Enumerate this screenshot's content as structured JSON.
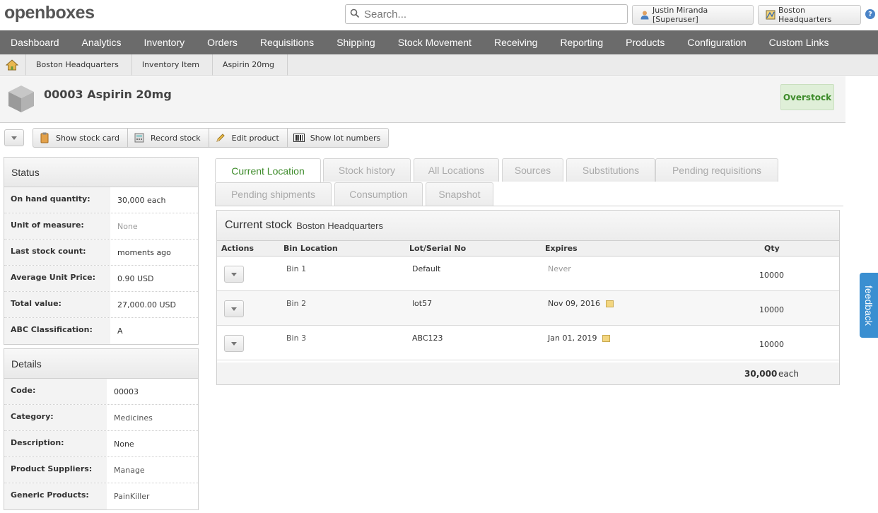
{
  "header": {
    "logo": "openboxes",
    "search_placeholder": "Search...",
    "user_label": "Justin Miranda [Superuser]",
    "location_label": "Boston Headquarters",
    "help_icon": "question-icon"
  },
  "nav": {
    "items": [
      "Dashboard",
      "Analytics",
      "Inventory",
      "Orders",
      "Requisitions",
      "Shipping",
      "Stock Movement",
      "Receiving",
      "Reporting",
      "Products",
      "Configuration",
      "Custom Links"
    ]
  },
  "breadcrumb": {
    "home_icon": "home-icon",
    "items": [
      "Boston Headquarters",
      "Inventory Item",
      "Aspirin 20mg"
    ]
  },
  "product": {
    "title": "00003 Aspirin 20mg",
    "badge": "Overstock",
    "badge_color": "#3d8b2a"
  },
  "toolbar": {
    "buttons": [
      {
        "label": "Show stock card",
        "icon": "clipboard-icon"
      },
      {
        "label": "Record stock",
        "icon": "calculator-icon"
      },
      {
        "label": "Edit product",
        "icon": "pencil-icon"
      },
      {
        "label": "Show lot numbers",
        "icon": "barcode-icon"
      }
    ]
  },
  "status": {
    "title": "Status",
    "rows": [
      {
        "label": "On hand quantity:",
        "value": "30,000 each"
      },
      {
        "label": "Unit of measure:",
        "value": "None"
      },
      {
        "label": "Last stock count:",
        "value": "moments ago"
      },
      {
        "label": "Average Unit Price:",
        "value": "0.90 USD"
      },
      {
        "label": "Total value:",
        "value": "27,000.00 USD"
      },
      {
        "label": "ABC Classification:",
        "value": "A"
      }
    ]
  },
  "details": {
    "title": "Details",
    "rows": [
      {
        "label": "Code:",
        "value": "00003"
      },
      {
        "label": "Category:",
        "value": "Medicines"
      },
      {
        "label": "Description:",
        "value": "None"
      },
      {
        "label": "Product Suppliers:",
        "value": "Manage"
      },
      {
        "label": "Generic Products:",
        "value": "PainKiller"
      }
    ]
  },
  "tabs": [
    "Current Location",
    "Stock history",
    "All Locations",
    "Sources",
    "Substitutions",
    "Pending requisitions",
    "Pending shipments",
    "Consumption",
    "Snapshot"
  ],
  "stock": {
    "title": "Current stock",
    "subtitle": "Boston Headquarters",
    "columns": [
      "Actions",
      "Bin Location",
      "Lot/Serial No",
      "Expires",
      "Qty"
    ],
    "rows": [
      {
        "bin": "Bin 1",
        "lot": "Default",
        "expires": "Never",
        "qty": "10000"
      },
      {
        "bin": "Bin 2",
        "lot": "lot57",
        "expires": "Nov 09, 2016",
        "qty": "10000"
      },
      {
        "bin": "Bin 3",
        "lot": "ABC123",
        "expires": "Jan 01, 2019",
        "qty": "10000"
      }
    ],
    "total_qty": "30,000",
    "total_unit": "each"
  },
  "feedback": "feedback"
}
